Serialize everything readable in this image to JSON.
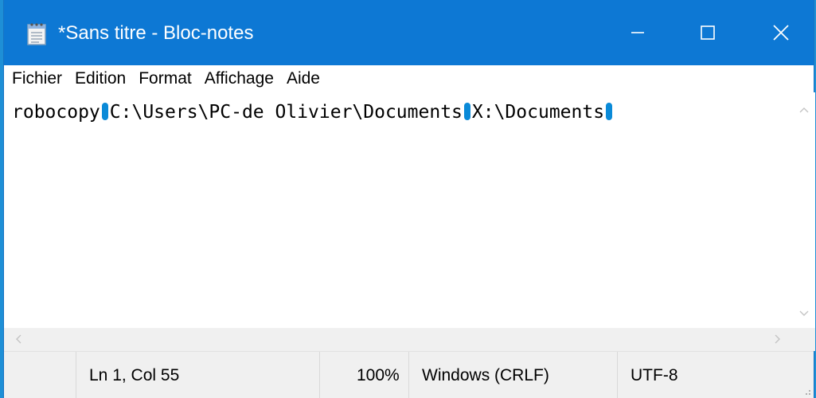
{
  "window": {
    "title": "*Sans titre - Bloc-notes",
    "app_icon": "notepad-icon"
  },
  "titlebar_buttons": {
    "minimize": "minimize-icon",
    "maximize": "maximize-icon",
    "close": "close-icon"
  },
  "menu": {
    "items": [
      "Fichier",
      "Edition",
      "Format",
      "Affichage",
      "Aide"
    ]
  },
  "editor": {
    "segments": [
      "robocopy",
      "C:\\Users\\PC-de Olivier\\Documents",
      "X:\\Documents"
    ],
    "tab_marker_color": "#0a8ad8"
  },
  "statusbar": {
    "position": "Ln 1, Col 55",
    "zoom": "100%",
    "line_ending": "Windows (CRLF)",
    "encoding": "UTF-8"
  },
  "colors": {
    "titlebar": "#0d78d4",
    "desktop": "#1e8fd6"
  }
}
